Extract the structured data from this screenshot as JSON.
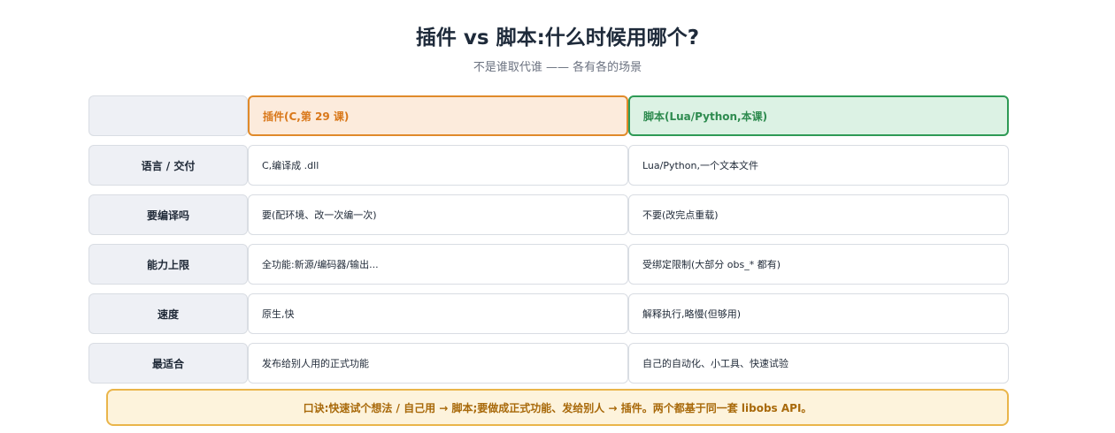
{
  "title": "插件 vs 脚本:什么时候用哪个?",
  "subtitle": "不是谁取代谁 —— 各有各的场景",
  "table": {
    "header": {
      "corner": "",
      "plugin": "插件(C,第 29 课)",
      "script": "脚本(Lua/Python,本课)"
    },
    "rows": [
      {
        "label": "语言 / 交付",
        "plugin": "C,编译成 .dll",
        "script": "Lua/Python,一个文本文件"
      },
      {
        "label": "要编译吗",
        "plugin": "要(配环境、改一次编一次)",
        "script": "不要(改完点重载)"
      },
      {
        "label": "能力上限",
        "plugin": "全功能:新源/编码器/输出...",
        "script": "受绑定限制(大部分 obs_* 都有)"
      },
      {
        "label": "速度",
        "plugin": "原生,快",
        "script": "解释执行,略慢(但够用)"
      },
      {
        "label": "最适合",
        "plugin": "发布给别人用的正式功能",
        "script": "自己的自动化、小工具、快速试验"
      }
    ]
  },
  "tip": "口诀:快速试个想法 / 自己用 → 脚本;要做成正式功能、发给别人 → 插件。两个都基于同一套 libobs API。",
  "colors": {
    "plugin_accent": "#e08a2a",
    "script_accent": "#2e9a55",
    "tip_border": "#eab54a"
  }
}
